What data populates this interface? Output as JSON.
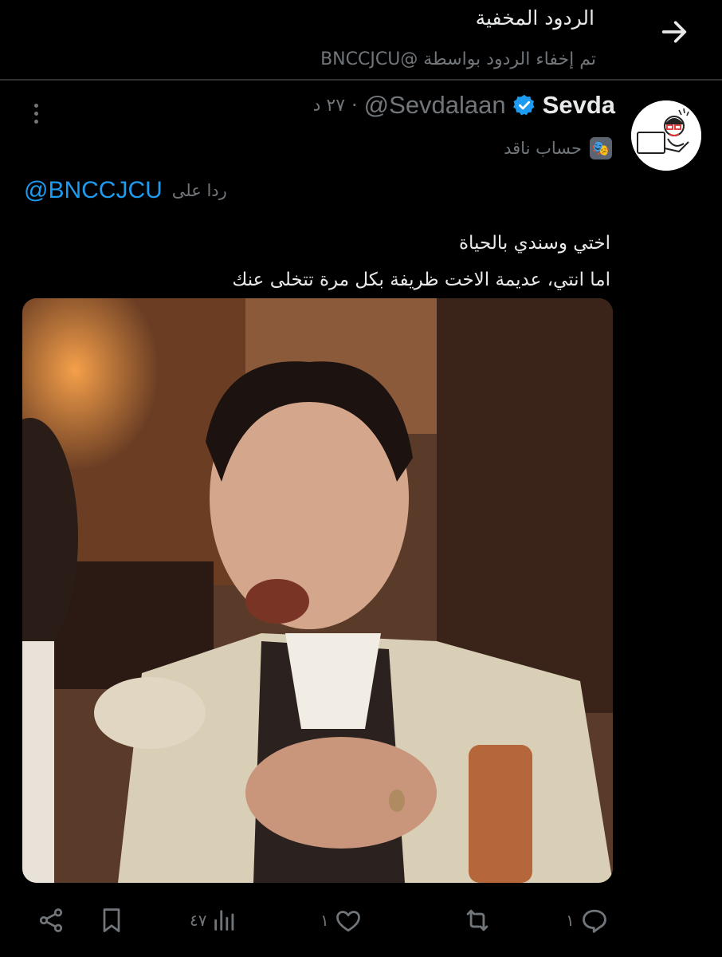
{
  "header": {
    "title": "الردود المخفية",
    "subtitle": "تم إخفاء الردود بواسطة @BNCCJCU"
  },
  "tweet": {
    "author_name": "Sevda",
    "handle": "@Sevdalaan",
    "time": "٢٧ د",
    "account_label": "حساب ناقد",
    "reply_prefix": "ردا على",
    "reply_to": "@BNCCJCU",
    "text_line1": "اختي وسندي بالحياة",
    "text_line2": "اما انتي، عديمة الاخت ظريفة بكل مرة تتخلى عنك",
    "media_description": "GIF of a man in a tan suit laughing in a restaurant"
  },
  "actions": {
    "replies": "١",
    "retweets": "",
    "likes": "١",
    "views": "٤٧"
  },
  "colors": {
    "background": "#000000",
    "text_primary": "#e7e9ea",
    "text_secondary": "#71767b",
    "accent": "#1d9bf0",
    "divider": "#2f3336"
  },
  "icons": [
    "arrow-right-icon",
    "more-vertical-icon",
    "verified-badge-icon",
    "theater-mask-icon",
    "reply-icon",
    "retweet-icon",
    "like-icon",
    "views-icon",
    "bookmark-icon",
    "share-icon"
  ]
}
